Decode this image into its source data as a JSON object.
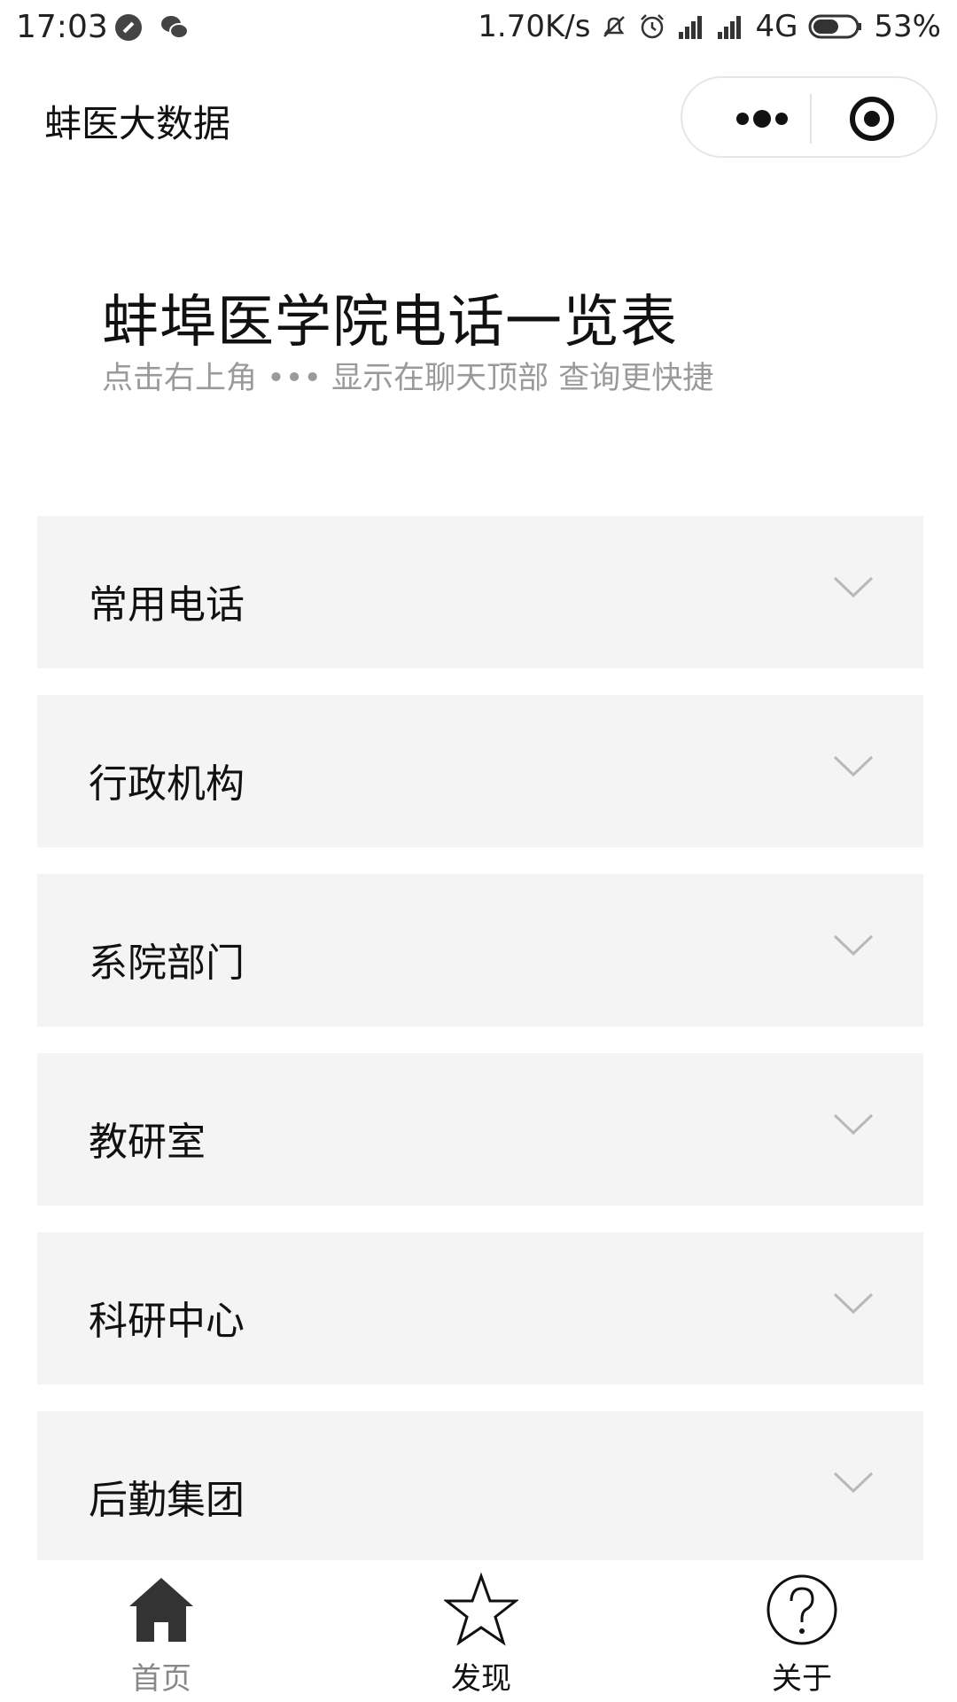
{
  "status_bar": {
    "time": "17:03",
    "speed": "1.70K/s",
    "network": "4G",
    "battery": "53%",
    "left_icons": [
      "do-not-disturb-icon",
      "wechat-icon"
    ],
    "right_icons": [
      "mute-icon",
      "alarm-icon",
      "signal-icon",
      "signal-icon",
      "battery-icon"
    ]
  },
  "nav": {
    "title": "蚌医大数据",
    "capsule_icons": [
      "more-dots-icon",
      "close-target-icon"
    ]
  },
  "header": {
    "title": "蚌埠医学院电话一览表",
    "subtitle": "点击右上角 ••• 显示在聊天顶部 查询更快捷"
  },
  "sections": [
    {
      "label": "常用电话"
    },
    {
      "label": "行政机构"
    },
    {
      "label": "系院部门"
    },
    {
      "label": "教研室"
    },
    {
      "label": "科研中心"
    },
    {
      "label": "后勤集团"
    }
  ],
  "tabs": [
    {
      "label": "首页",
      "icon": "home-icon",
      "active": true
    },
    {
      "label": "发现",
      "icon": "star-icon",
      "active": false
    },
    {
      "label": "关于",
      "icon": "question-icon",
      "active": false
    }
  ],
  "colors": {
    "section_bg": "#f4f4f4",
    "subtitle": "#9a9a9a",
    "chevron": "#b8b8b8",
    "tab_active_icon": "#333333",
    "tab_active_label": "#888888"
  }
}
